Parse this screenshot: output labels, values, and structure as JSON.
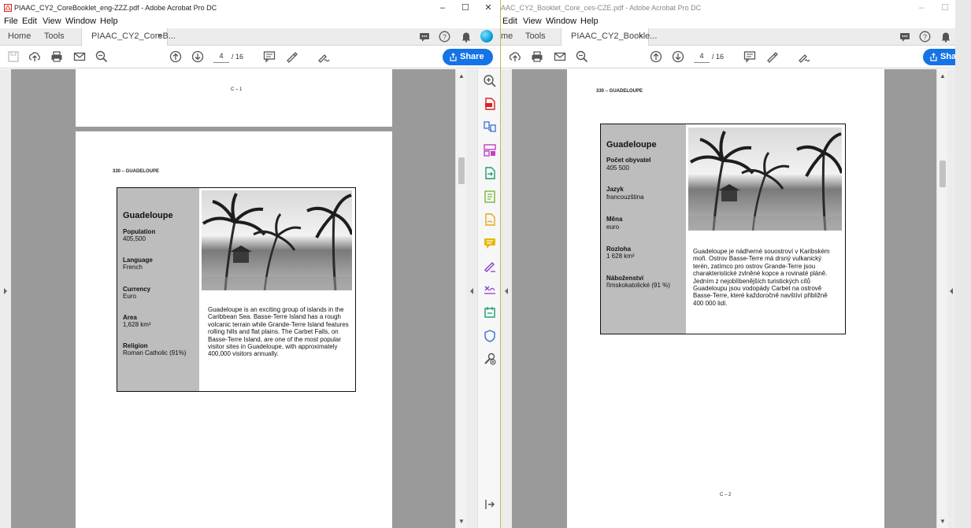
{
  "left_window": {
    "title": "PIAAC_CY2_CoreBooklet_eng-ZZZ.pdf - Adobe Acrobat Pro DC",
    "menu": [
      "File",
      "Edit",
      "View",
      "Window",
      "Help"
    ],
    "tabs": {
      "home": "Home",
      "tools": "Tools",
      "doc": "PIAAC_CY2_CoreB...",
      "close": "×"
    },
    "page_current": "4",
    "page_total": "/ 16",
    "share_label": "Share",
    "prev_page_footer": "C – 1",
    "page_header": "330 – GUADELOUPE",
    "card": {
      "name": "Guadeloupe",
      "facts": [
        {
          "label": "Population",
          "value": "405,500"
        },
        {
          "label": "Language",
          "value": "French"
        },
        {
          "label": "Currency",
          "value": "Euro"
        },
        {
          "label": "Area",
          "value": "1,628 km²"
        },
        {
          "label": "Religion",
          "value": "Roman Catholic (91%)"
        }
      ],
      "description": "Guadeloupe is an exciting group of islands in the Caribbean Sea. Basse-Terre Island has a rough volcanic terrain while Grande-Terre Island features rolling hills and flat plains. The Carbet Falls, on Basse-Terre Island, are one of the most popular visitor sites in Guadeloupe, with approximately 400,000 visitors annually."
    }
  },
  "right_window": {
    "title": "AAC_CY2_Booklet_Core_ces-CZE.pdf - Adobe Acrobat Pro DC",
    "menu": [
      "Edit",
      "View",
      "Window",
      "Help"
    ],
    "tabs": {
      "home": "me",
      "tools": "Tools",
      "doc": "PIAAC_CY2_Bookle...",
      "close": "×"
    },
    "page_current": "4",
    "page_total": "/ 16",
    "share_label": "Sha",
    "page_header": "330 – GUADELOUPE",
    "page_footer": "C – 2",
    "card": {
      "name": "Guadeloupe",
      "facts": [
        {
          "label": "Počet obyvatel",
          "value": "405 500"
        },
        {
          "label": "Jazyk",
          "value": "francouzština"
        },
        {
          "label": "Měna",
          "value": "euro"
        },
        {
          "label": "Rozloha",
          "value": "1 628 km²"
        },
        {
          "label": "Náboženství",
          "value": "římskokatolické (91 %)"
        }
      ],
      "description": "Guadeloupe je nádherné souostroví v Karibském moři. Ostrov Basse-Terre má drsný vulkanický terén, zatímco pro ostrov Grande-Terre jsou charakteristické zvlněné kopce a rovinaté pláně. Jedním z nejoblíbenějších turistických cílů Guadeloupu jsou vodopády Carbet na ostrově Basse-Terre, které každoročně navštíví přibližně 400 000 lidí."
    }
  },
  "icons": {
    "toolbar": [
      "save-icon",
      "upload-icon",
      "print-icon",
      "email-icon",
      "zoom-out-icon",
      "page-up-icon",
      "page-down-icon",
      "comment-icon",
      "highlight-icon",
      "sign-icon"
    ],
    "tools_pane": [
      "zoom-in-icon",
      "create-pdf-icon",
      "combine-icon",
      "organize-icon",
      "export-icon",
      "edit-pdf-icon",
      "request-sign-icon",
      "comment-tool-icon",
      "fill-sign-icon",
      "certificate-icon",
      "compress-icon",
      "protect-icon",
      "more-tools-icon",
      "collapse-pane-icon"
    ]
  },
  "colors": {
    "accent": "#1473e6",
    "pdf_red": "#e02020",
    "page_bg": "#9a9a9a",
    "card_sidebar": "#bdbdbd"
  }
}
